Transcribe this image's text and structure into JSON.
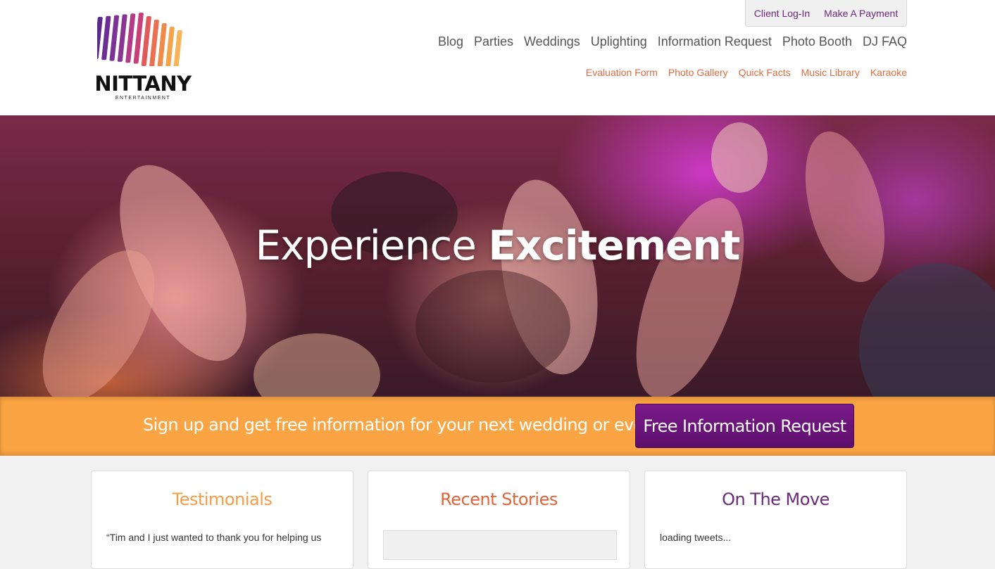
{
  "brand": {
    "name": "NITTANY",
    "tagline": "ENTERTAINMENT",
    "bar_colors": [
      "#5a2a8a",
      "#6a2e94",
      "#7c3396",
      "#8a3493",
      "#b23a86",
      "#c8407a",
      "#e05a5a",
      "#ea7050",
      "#f08a48",
      "#f5a34a",
      "#f8b356"
    ]
  },
  "utility_nav": {
    "login": "Client Log-In",
    "payment": "Make A Payment"
  },
  "main_nav": [
    "Blog",
    "Parties",
    "Weddings",
    "Uplighting",
    "Information Request",
    "Photo Booth",
    "DJ FAQ"
  ],
  "sub_nav": [
    "Evaluation Form",
    "Photo Gallery",
    "Quick Facts",
    "Music Library",
    "Karaoke"
  ],
  "hero": {
    "title_light": "Experience",
    "title_bold": "Excitement"
  },
  "cta": {
    "text": "Sign up and get free information for your next wedding or event!",
    "button": "Free Information Request"
  },
  "cards": {
    "testimonials": {
      "title": "Testimonials",
      "excerpt": "“Tim and I just wanted to thank you for helping us"
    },
    "stories": {
      "title": "Recent Stories"
    },
    "tweets": {
      "title": "On The Move",
      "status": "loading tweets..."
    }
  },
  "colors": {
    "accent_orange": "#fba443",
    "accent_purple": "#5d0f6c",
    "link_orange": "#e06b40"
  }
}
